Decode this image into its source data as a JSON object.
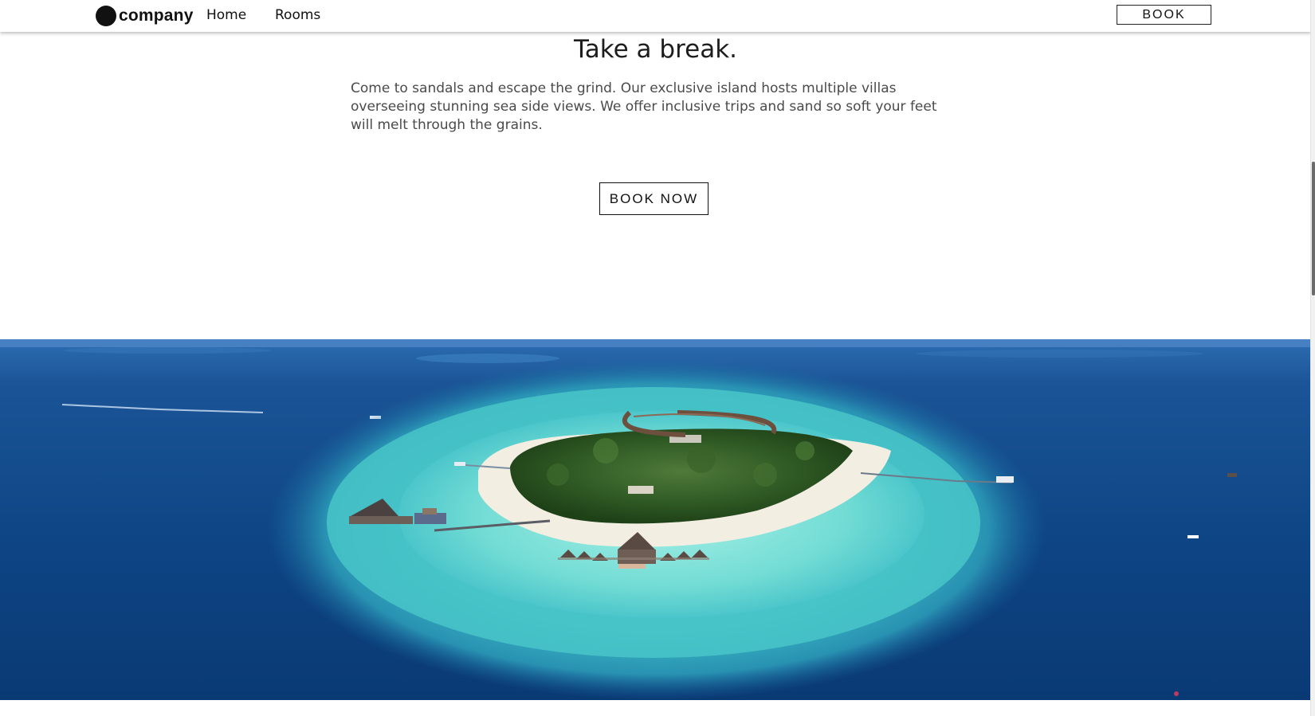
{
  "nav": {
    "logo_text": "company",
    "links": [
      {
        "label": "Home"
      },
      {
        "label": "Rooms"
      }
    ],
    "book_label": "BOOK"
  },
  "hero": {
    "headline": "Take a break.",
    "body": "Come to sandals and escape the grind. Our exclusive island hosts multiple villas overseeing stunning sea side views. We offer inclusive trips and sand so soft your feet will melt through the grains.",
    "cta_label": "BOOK NOW"
  },
  "image": {
    "subject": "aerial view of a tropical island resort with overwater villas",
    "colors": {
      "deep_sea": "#0b3f7a",
      "lagoon": "#4fd0cf",
      "sand": "#f3eee2",
      "vegetation": "#2f5a24"
    }
  }
}
